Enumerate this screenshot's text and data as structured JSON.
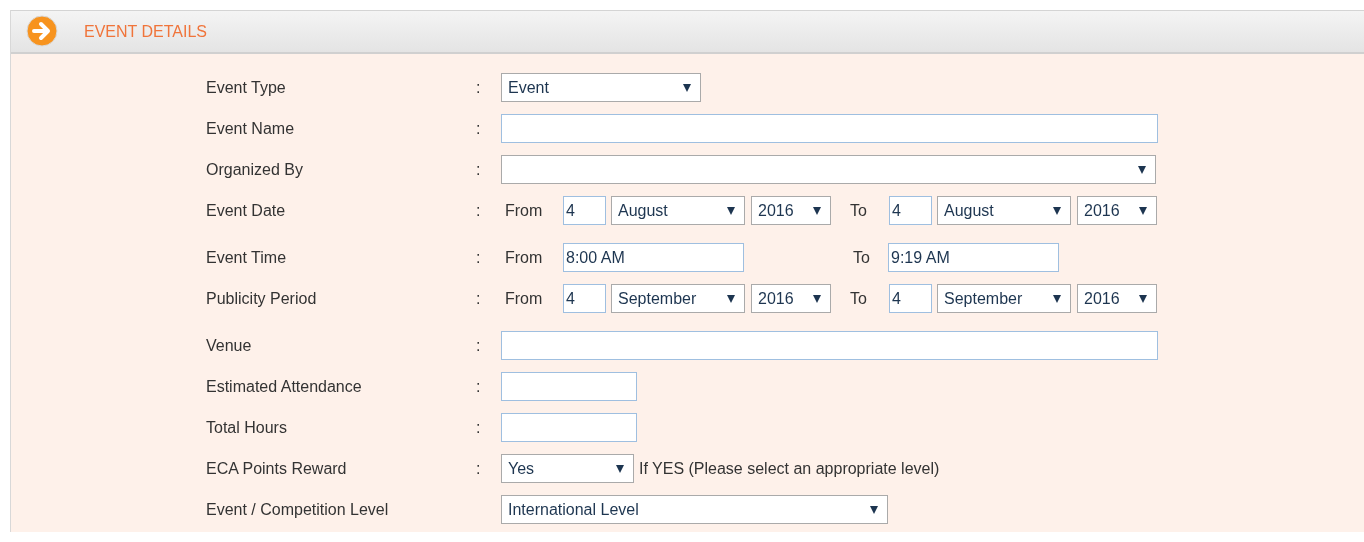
{
  "section": {
    "title": "EVENT DETAILS"
  },
  "fields": [
    {
      "kind": "short-select",
      "label": "Event Type",
      "colon": ":",
      "value": "Event"
    },
    {
      "kind": "long-input",
      "label": "Event Name",
      "colon": ":"
    },
    {
      "kind": "long-select",
      "label": "Organized By",
      "colon": ":"
    },
    {
      "kind": "date-range",
      "label": "Event Date",
      "colon": ":",
      "from_label": "From",
      "from": {
        "day": "4",
        "month": "August",
        "year": "2016"
      },
      "to_label": "To",
      "to": {
        "day": "4",
        "month": "August",
        "year": "2016"
      }
    },
    {
      "kind": "time-range",
      "label": "Event Time",
      "colon": ":",
      "from_label": "From",
      "from": "8:00 AM",
      "to_label": "To",
      "to": "9:19 AM"
    },
    {
      "kind": "date-range",
      "label": "Publicity Period",
      "colon": ":",
      "from_label": "From",
      "from": {
        "day": "4",
        "month": "September",
        "year": "2016"
      },
      "to_label": "To",
      "to": {
        "day": "4",
        "month": "September",
        "year": "2016"
      }
    },
    {
      "kind": "long-input",
      "label": "Venue",
      "colon": ":"
    },
    {
      "kind": "small-input",
      "label": "Estimated Attendance",
      "colon": ":"
    },
    {
      "kind": "small-input",
      "label": "Total Hours",
      "colon": ":"
    },
    {
      "kind": "note-select",
      "label": "ECA Points Reward",
      "colon": ":",
      "value": "Yes",
      "note": "If YES (Please select an appropriate level)"
    },
    {
      "kind": "medium-select",
      "label": "Event / Competition Level",
      "value": "International Level"
    }
  ]
}
